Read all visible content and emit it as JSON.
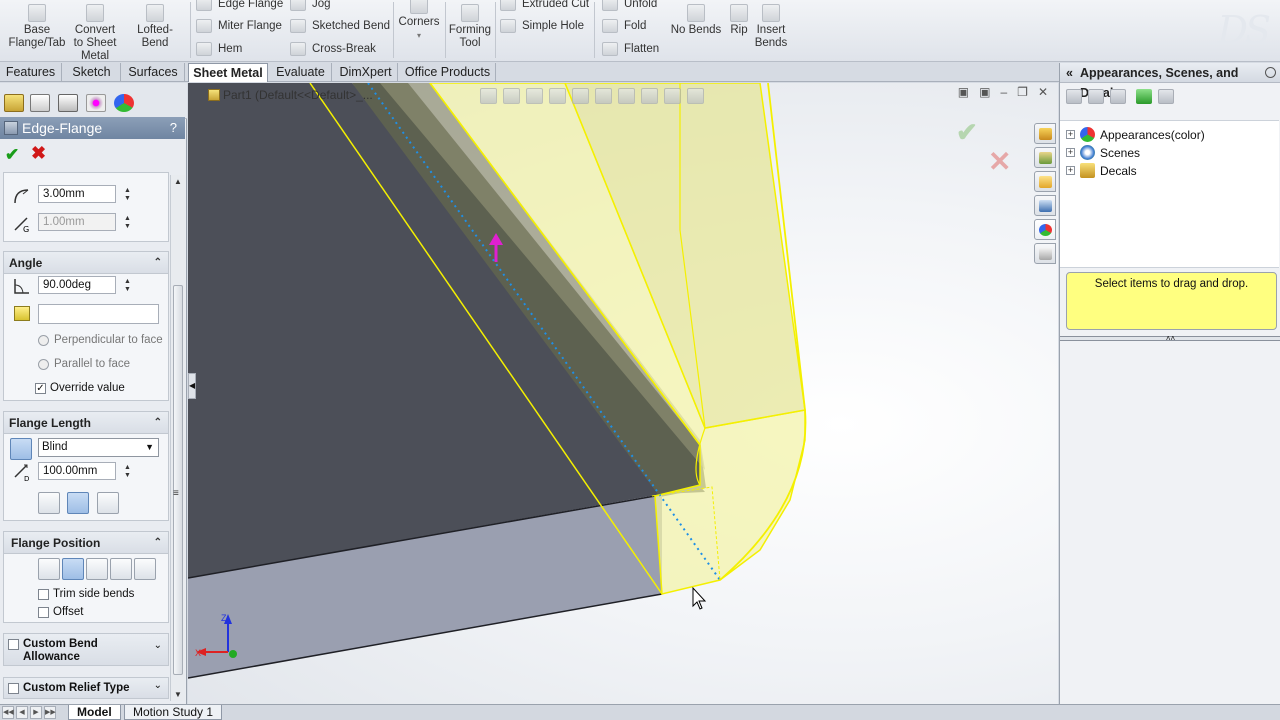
{
  "ribbon": {
    "base_flange": "Base Flange/Tab",
    "convert_to_sheet_metal": "Convert to Sheet Metal",
    "lofted_bend": "Lofted-Bend",
    "edge_flange": "Edge Flange",
    "miter_flange": "Miter Flange",
    "hem": "Hem",
    "jog": "Jog",
    "sketched_bend": "Sketched Bend",
    "cross_break": "Cross-Break",
    "corners": "Corners",
    "forming_tool": "Forming Tool",
    "extruded_cut": "Extruded Cut",
    "simple_hole": "Simple Hole",
    "unfold": "Unfold",
    "fold": "Fold",
    "flatten": "Flatten",
    "no_bends": "No Bends",
    "rip": "Rip",
    "insert_bends": "Insert Bends"
  },
  "tabs": [
    "Features",
    "Sketch",
    "Surfaces",
    "Sheet Metal",
    "Evaluate",
    "DimXpert",
    "Office Products"
  ],
  "active_tab": "Sheet Metal",
  "property_manager": {
    "title": "Edge-Flange",
    "help": "?",
    "bend_radius": "3.00mm",
    "gap_distance": "1.00mm",
    "angle_group": {
      "header": "Angle",
      "value": "90.00deg",
      "face_field": "",
      "perpendicular_label": "Perpendicular to face",
      "parallel_label": "Parallel to face",
      "override_label": "Override value",
      "override_checked": true
    },
    "flange_length_group": {
      "header": "Flange Length",
      "end_condition": "Blind",
      "length": "100.00mm"
    },
    "flange_position_group": {
      "header": "Flange Position",
      "trim_side_bends": "Trim side bends",
      "offset": "Offset"
    },
    "custom_bend_allowance": "Custom Bend Allowance",
    "custom_relief_type": "Custom Relief Type"
  },
  "viewport": {
    "part_label": "Part1 (Default<<Default>_...",
    "axis_z": "Z",
    "axis_x": "X"
  },
  "task_pane": {
    "title": "Appearances, Scenes, and Decals",
    "tree": [
      "Appearances(color)",
      "Scenes",
      "Decals"
    ],
    "hint": "Select items to drag and drop."
  },
  "bottom_tabs": [
    "Model",
    "Motion Study 1"
  ],
  "colors": {
    "flange_fill": "#f2f3a8",
    "edge_yellow": "#f4f000",
    "dark_face": "#4c4f58",
    "side_face": "#9a9fb0",
    "selected_edge": "#1e8fe6",
    "arrow": "#e020d0"
  }
}
